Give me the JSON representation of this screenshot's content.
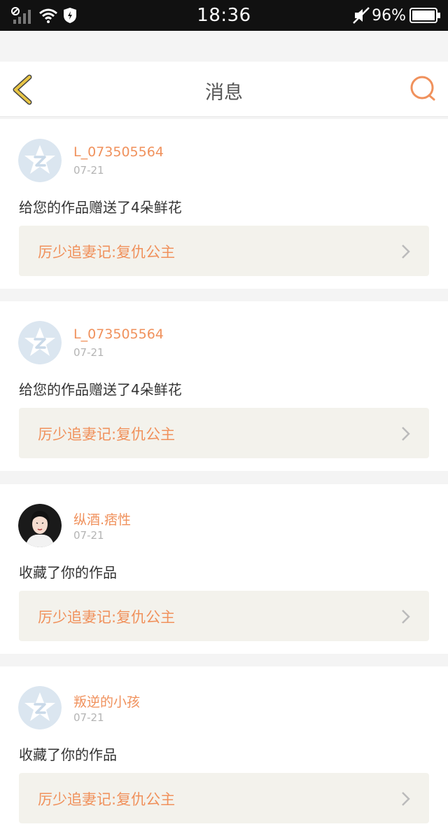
{
  "status_bar": {
    "time": "18:36",
    "battery": "96%",
    "icons": [
      "signal-icon",
      "wifi-icon",
      "shield-icon",
      "mute-icon",
      "battery-icon"
    ]
  },
  "header": {
    "title": "消息",
    "back_icon": "back-chevron-icon",
    "search_icon": "search-icon"
  },
  "colors": {
    "accent": "#f0915c",
    "back_icon": "#e8c545",
    "link_bg": "#f3f2ec",
    "avatar_default": "#dbe6f0"
  },
  "messages": [
    {
      "user": "L_073505564",
      "date": "07-21",
      "action": "给您的作品赠送了4朵鲜花",
      "work": "厉少追妻记:复仇公主",
      "avatar": "default"
    },
    {
      "user": "L_073505564",
      "date": "07-21",
      "action": "给您的作品赠送了4朵鲜花",
      "work": "厉少追妻记:复仇公主",
      "avatar": "default"
    },
    {
      "user": "纵酒.痞性",
      "date": "07-21",
      "action": "收藏了你的作品",
      "work": "厉少追妻记:复仇公主",
      "avatar": "photo"
    },
    {
      "user": "叛逆的小孩",
      "date": "07-21",
      "action": "收藏了你的作品",
      "work": "厉少追妻记:复仇公主",
      "avatar": "default"
    }
  ]
}
